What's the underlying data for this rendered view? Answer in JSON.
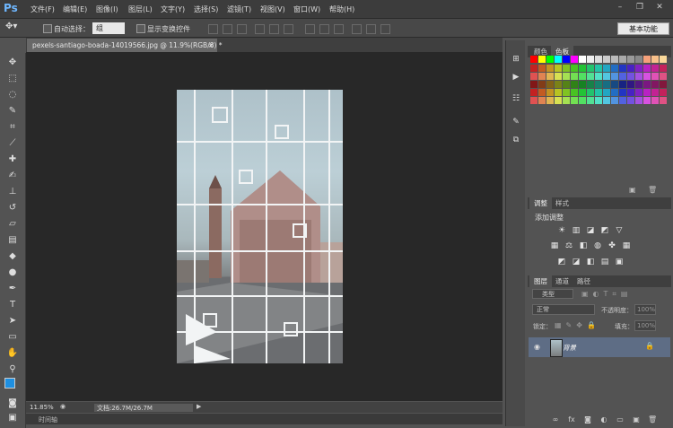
{
  "app": {
    "logo": "Ps"
  },
  "menubar": {
    "items": [
      "文件(F)",
      "编辑(E)",
      "图像(I)",
      "图层(L)",
      "文字(Y)",
      "选择(S)",
      "滤镜(T)",
      "视图(V)",
      "窗口(W)",
      "帮助(H)"
    ],
    "window_controls": {
      "minimize": "–",
      "restore": "❐",
      "close": "✕"
    }
  },
  "options": {
    "auto_select_label": "自动选择：",
    "auto_select_value": "组",
    "show_transform_label": "显示变换控件",
    "workspace_label": "基本功能"
  },
  "document": {
    "tab_title": "pexels-santiago-boada-14019566.jpg @ 11.9%(RGB/8) *",
    "tab_close": "×"
  },
  "status": {
    "zoom": "11.85%",
    "doc_size": "文档:26.7M/26.7M"
  },
  "timeline": {
    "label": "时间轴"
  },
  "panels": {
    "color_tabs": [
      "颜色",
      "色板"
    ],
    "adjust_tabs": [
      "调整",
      "样式"
    ],
    "adjust_title": "添加调整",
    "layer_tabs": [
      "图层",
      "通道",
      "路径"
    ],
    "layer_filter": "类型",
    "blend_mode": "正常",
    "opacity_label": "不透明度：",
    "opacity_value": "100%",
    "lock_label": "锁定：",
    "fill_label": "填充：",
    "fill_value": "100%",
    "layer_name": "背景"
  },
  "colors": {
    "foreground": "#1e8fe0",
    "background": "#ffffff",
    "layer_selected": "#5e6d85"
  },
  "icons": {
    "tools": [
      "move-icon",
      "marquee-icon",
      "lasso-icon",
      "quick-select-icon",
      "crop-icon",
      "eyedropper-icon",
      "healing-icon",
      "brush-icon",
      "stamp-icon",
      "history-brush-icon",
      "eraser-icon",
      "gradient-icon",
      "blur-icon",
      "dodge-icon",
      "pen-icon",
      "type-icon",
      "path-select-icon",
      "shape-icon",
      "hand-icon",
      "zoom-icon"
    ]
  }
}
